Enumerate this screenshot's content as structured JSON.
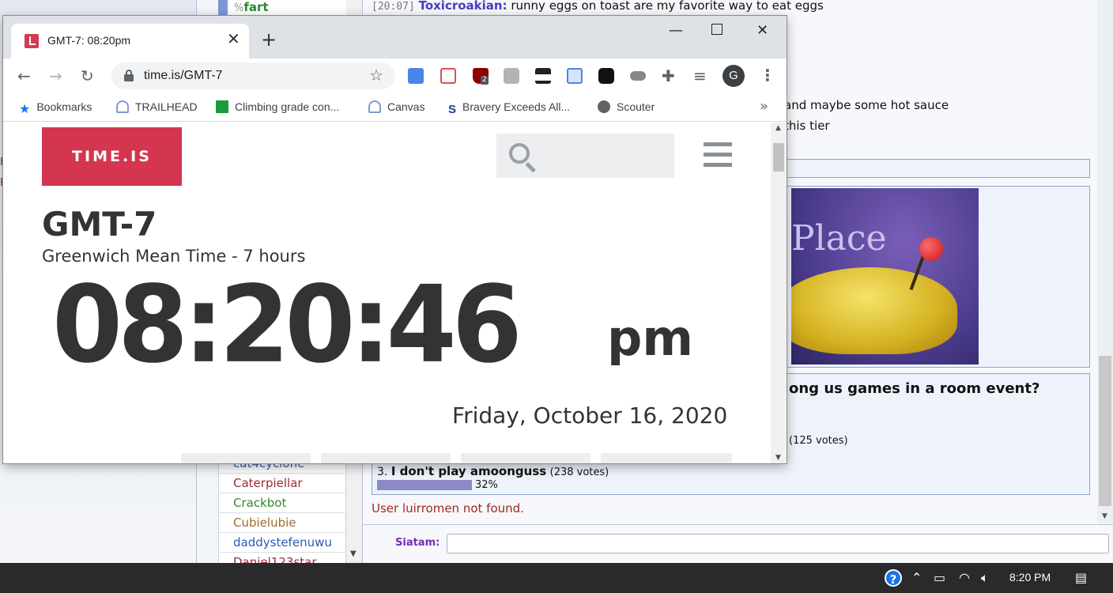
{
  "chat": {
    "top_user": "fart",
    "top_user_pct": "%",
    "users": [
      {
        "name": "cat4cyclone",
        "color": "#3e5fb0"
      },
      {
        "name": "Caterpiellar",
        "color": "#a0283a"
      },
      {
        "name": "Crackbot",
        "color": "#2e8a2e"
      },
      {
        "name": "Cubielubie",
        "color": "#a06a2a"
      },
      {
        "name": "daddystefenuwu",
        "color": "#2a5ab8"
      },
      {
        "name": "Daniel123star",
        "color": "#a0283a"
      }
    ],
    "left_letters": [
      "F",
      "P"
    ],
    "messages": [
      {
        "ts": "[20:07]",
        "nick": "Toxicroakian:",
        "text": "runny eggs on toast are my favorite way to eat eggs"
      },
      {
        "text": "and maybe some hot sauce"
      },
      {
        "text": "this tier"
      }
    ],
    "image_text": "Place",
    "poll": {
      "question": "ong us games in a room event?",
      "opt2_votes": "(125 votes)",
      "opt3_num": "3.",
      "opt3_label": "I don't play amoonguss",
      "opt3_votes": "(238 votes)",
      "opt3_pct": "32%",
      "opt3_fraction": 0.32
    },
    "notice": "User luirromen not found.",
    "sender_name": "Siatam:",
    "input_value": ""
  },
  "browser": {
    "tab_title": "GMT-7: 08:20pm",
    "url": "time.is/GMT-7",
    "avatar_letter": "G",
    "bookmarks": [
      {
        "label": "Bookmarks",
        "icon": "star-icon"
      },
      {
        "label": "TRAILHEAD",
        "icon": "trailhead-icon"
      },
      {
        "label": "Climbing grade con...",
        "icon": "mec-icon"
      },
      {
        "label": "Canvas",
        "icon": "canvas-icon"
      },
      {
        "label": "Bravery Exceeds All...",
        "icon": "bravery-icon"
      },
      {
        "label": "Scouter",
        "icon": "scouter-icon"
      }
    ],
    "more_label": "»",
    "ublock_badge": "2"
  },
  "page": {
    "logo": "TIME.IS",
    "timezone": "GMT-7",
    "timezone_desc": "Greenwich Mean Time - 7 hours",
    "clock": "08:20:46",
    "ampm": "pm",
    "date": "Friday, October 16, 2020"
  },
  "taskbar": {
    "time": "8:20 PM"
  },
  "colors": {
    "accent": "#d4364f",
    "text_dark": "#333333",
    "chat_nick": "#4b3cc2",
    "poll_bar": "#8d88c6"
  }
}
